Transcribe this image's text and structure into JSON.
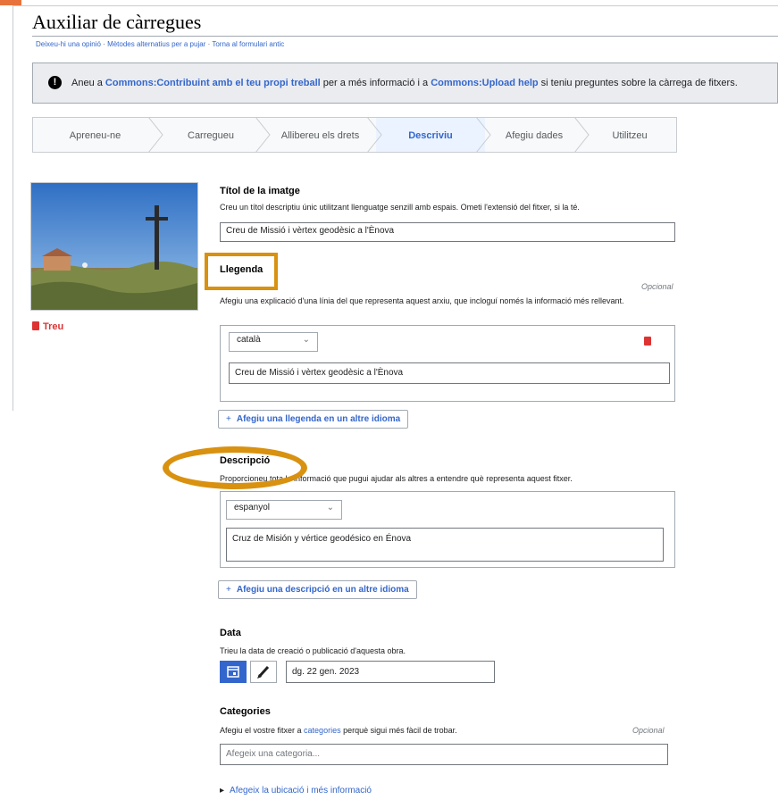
{
  "header": {
    "title": "Auxiliar de càrregues",
    "links": [
      "Deixeu-hi una opinió",
      "Mètodes alternatius per a pujar",
      "Torna al formulari antic"
    ]
  },
  "notice": {
    "icon": "exclamation-icon",
    "t1": "Aneu a ",
    "link1": "Commons:Contribuint amb el teu propi treball",
    "t2": " per a més informació i a ",
    "link2": "Commons:Upload help",
    "t3": " si teniu preguntes sobre la càrrega de fitxers."
  },
  "steps": [
    "Apreneu-ne",
    "Carregueu",
    "Allibereu els drets",
    "Descriviu",
    "Afegiu dades",
    "Utilitzeu"
  ],
  "active_step": "Descriviu",
  "file": {
    "remove_label": "Treu"
  },
  "title_field": {
    "label": "Títol de la imatge",
    "help": "Creu un títol descriptiu únic utilitzant llenguatge senzill amb espais. Ometi l'extensió del fitxer, si la té.",
    "value": "Creu de Missió i vèrtex geodèsic a l'Ènova"
  },
  "caption": {
    "label": "Llegenda",
    "optional": "Opcional",
    "help": "Afegiu una explicació d'una línia del que representa aquest arxiu, que incloguí només la informació més rellevant.",
    "language": "català",
    "value": "Creu de Missió i vèrtex geodèsic a l'Ènova",
    "add_label": "Afegiu una llegenda en un altre idioma"
  },
  "description": {
    "label": "Descripció",
    "help": "Proporcioneu tota la informació que pugui ajudar als altres a entendre què representa aquest fitxer.",
    "language": "espanyol",
    "value": "Cruz de Misión y vértice geodésico en Énova",
    "add_label": "Afegiu una descripció en un altre idioma"
  },
  "date": {
    "label": "Data",
    "help": "Trieu la data de creació o publicació d'aquesta obra.",
    "value": "dg. 22 gen. 2023"
  },
  "categories": {
    "label": "Categories",
    "optional": "Opcional",
    "help_prefix": "Afegiu el vostre fitxer a ",
    "help_link": "categories",
    "help_suffix": " perquè sigui més fàcil de trobar.",
    "placeholder": "Afegeix una categoria..."
  },
  "more_info": "Afegeix la ubicació i més informació",
  "colors": {
    "accent": "#3366cc",
    "highlight": "#d99110",
    "danger": "#d33333",
    "active_step_bg": "#eaf3ff"
  }
}
